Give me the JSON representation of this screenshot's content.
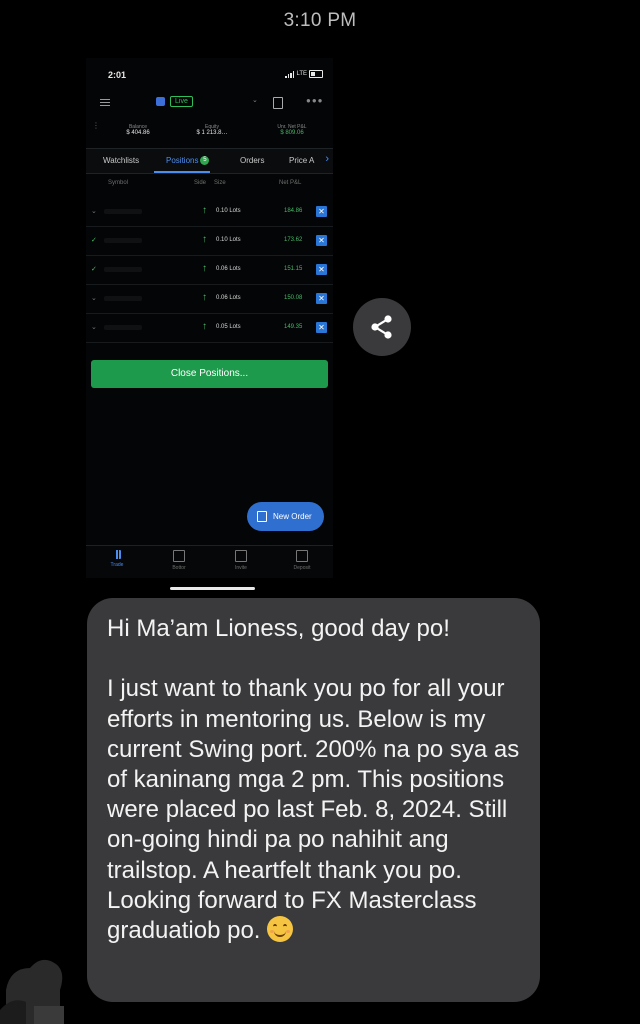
{
  "status_time": "3:10 PM",
  "phone_screenshot": {
    "status_time": "2:01",
    "network": "LTE",
    "account_mode": "Live",
    "metrics": [
      {
        "label": "Balance",
        "value": "$ 404.86"
      },
      {
        "label": "Equity",
        "value": "$ 1 213.8…"
      },
      {
        "label": "Unr. Net P&L",
        "value": "$ 809.06"
      }
    ],
    "tabs": [
      "Watchlists",
      "Positions",
      "Orders",
      "Price A"
    ],
    "positions_count": "5",
    "columns": {
      "symbol": "Symbol",
      "side": "Side",
      "size": "Size",
      "pl": "Net P&L"
    },
    "rows": [
      {
        "size": "0.10 Lots",
        "pl": "184.86"
      },
      {
        "size": "0.10 Lots",
        "pl": "173.62"
      },
      {
        "size": "0.06 Lots",
        "pl": "151.15"
      },
      {
        "size": "0.06 Lots",
        "pl": "150.08"
      },
      {
        "size": "0.05 Lots",
        "pl": "149.35"
      }
    ],
    "close_button": "Close Positions...",
    "new_order_button": "New Order",
    "nav": [
      "Trade",
      "Bottor",
      "Invite",
      "Deposit"
    ]
  },
  "message": {
    "greeting": "Hi Ma’am Lioness, good day po!",
    "body": "I just want to thank you po for all your efforts in mentoring us. Below is my current Swing port. 200% na po sya as of kaninang mga 2 pm. This positions were placed po last Feb. 8, 2024. Still on-going hindi pa po nahihit ang trailstop. A heartfelt thank you po. Looking forward to FX Masterclass graduatiob po.",
    "emoji": "smiling-face-with-smiling-eyes"
  },
  "colors": {
    "bubble": "#3a3a3c",
    "profit_green": "#49b86a",
    "accent_blue": "#2f6fd0",
    "button_green": "#1e9a4c"
  }
}
